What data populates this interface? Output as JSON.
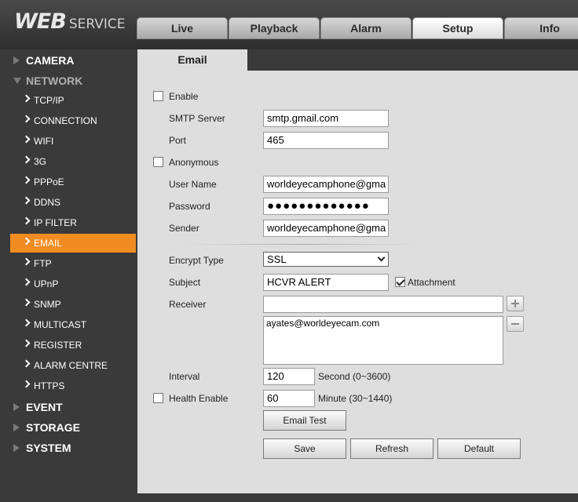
{
  "header": {
    "logo_main": "WEB",
    "logo_sub": "SERVICE",
    "tabs": [
      "Live",
      "Playback",
      "Alarm",
      "Setup",
      "Info"
    ],
    "active_tab": "Setup"
  },
  "sidebar": {
    "categories": {
      "camera": "CAMERA",
      "network": "NETWORK",
      "event": "EVENT",
      "storage": "STORAGE",
      "system": "SYSTEM"
    },
    "network_items": [
      "TCP/IP",
      "CONNECTION",
      "WIFI",
      "3G",
      "PPPoE",
      "DDNS",
      "IP FILTER",
      "EMAIL",
      "FTP",
      "UPnP",
      "SNMP",
      "MULTICAST",
      "REGISTER",
      "ALARM CENTRE",
      "HTTPS"
    ],
    "active_item": "EMAIL"
  },
  "page": {
    "title": "Email"
  },
  "form": {
    "enable_label": "Enable",
    "enable_checked": false,
    "smtp_label": "SMTP Server",
    "smtp_value": "smtp.gmail.com",
    "port_label": "Port",
    "port_value": "465",
    "anonymous_label": "Anonymous",
    "anonymous_checked": false,
    "username_label": "User Name",
    "username_value": "worldeyecamphone@gma",
    "password_label": "Password",
    "password_value": "●●●●●●●●●●●●●",
    "sender_label": "Sender",
    "sender_value": "worldeyecamphone@gma",
    "encrypt_label": "Encrypt Type",
    "encrypt_value": "SSL",
    "subject_label": "Subject",
    "subject_value": "HCVR ALERT",
    "attachment_label": "Attachment",
    "attachment_checked": true,
    "receiver_label": "Receiver",
    "receiver_input": "",
    "receiver_list": "ayates@worldeyecam.com",
    "interval_label": "Interval",
    "interval_value": "120",
    "interval_unit": "Second (0~3600)",
    "health_label": "Health Enable",
    "health_checked": false,
    "health_value": "60",
    "health_unit": "Minute (30~1440)"
  },
  "buttons": {
    "email_test": "Email Test",
    "save": "Save",
    "refresh": "Refresh",
    "default": "Default"
  }
}
